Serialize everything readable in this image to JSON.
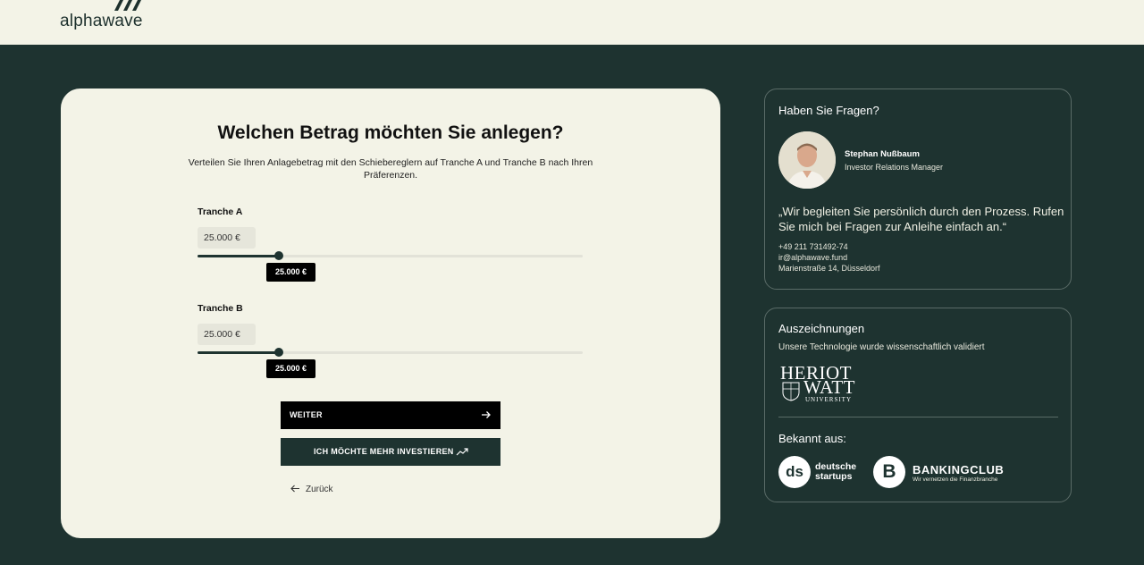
{
  "header": {
    "logo_text": "alphawave"
  },
  "investment_form": {
    "title": "Welchen Betrag möchten Sie anlegen?",
    "description": "Verteilen Sie Ihren Anlagebetrag mit den Schiebereglern auf Tranche A und Tranche B nach Ihren Präferenzen.",
    "tranches": [
      {
        "label": "Tranche A",
        "amount_value": "25.000 €",
        "slider_tag": "25.000 €",
        "slider_fraction": 0.21
      },
      {
        "label": "Tranche B",
        "amount_value": "25.000 €",
        "slider_tag": "25.000 €",
        "slider_fraction": 0.21
      }
    ],
    "next_button": "WEITER",
    "more_button": "ICH MÖCHTE MEHR INVESTIEREN",
    "back_link": "Zurück"
  },
  "contact_card": {
    "title": "Haben Sie Fragen?",
    "person_name": "Stephan Nußbaum",
    "person_role": "Investor Relations Manager",
    "quote": "„Wir begleiten Sie persönlich durch den Prozess. Rufen Sie mich bei Fragen zur Anleihe einfach an.“",
    "phone": "+49 211 731492-74",
    "email": "ir@alphawave.fund",
    "address": "Marienstraße 14, Düsseldorf"
  },
  "awards_card": {
    "title": "Auszeichnungen",
    "subtitle": "Unsere Technologie wurde wissenschaftlich validiert",
    "university_logo": {
      "line1": "HERIOT",
      "line2": "WATT",
      "line3": "UNIVERSITY"
    },
    "press_title": "Bekannt aus:",
    "press_logos": [
      {
        "mark": "ds",
        "name_line1": "deutsche",
        "name_line2": "startups"
      },
      {
        "mark": "B",
        "name": "BANKINGCLUB",
        "tagline": "Wir vernetzen die Finanzbranche"
      }
    ]
  },
  "colors": {
    "dark_green": "#1e3330",
    "cream": "#f3f3e7",
    "black": "#000000"
  }
}
